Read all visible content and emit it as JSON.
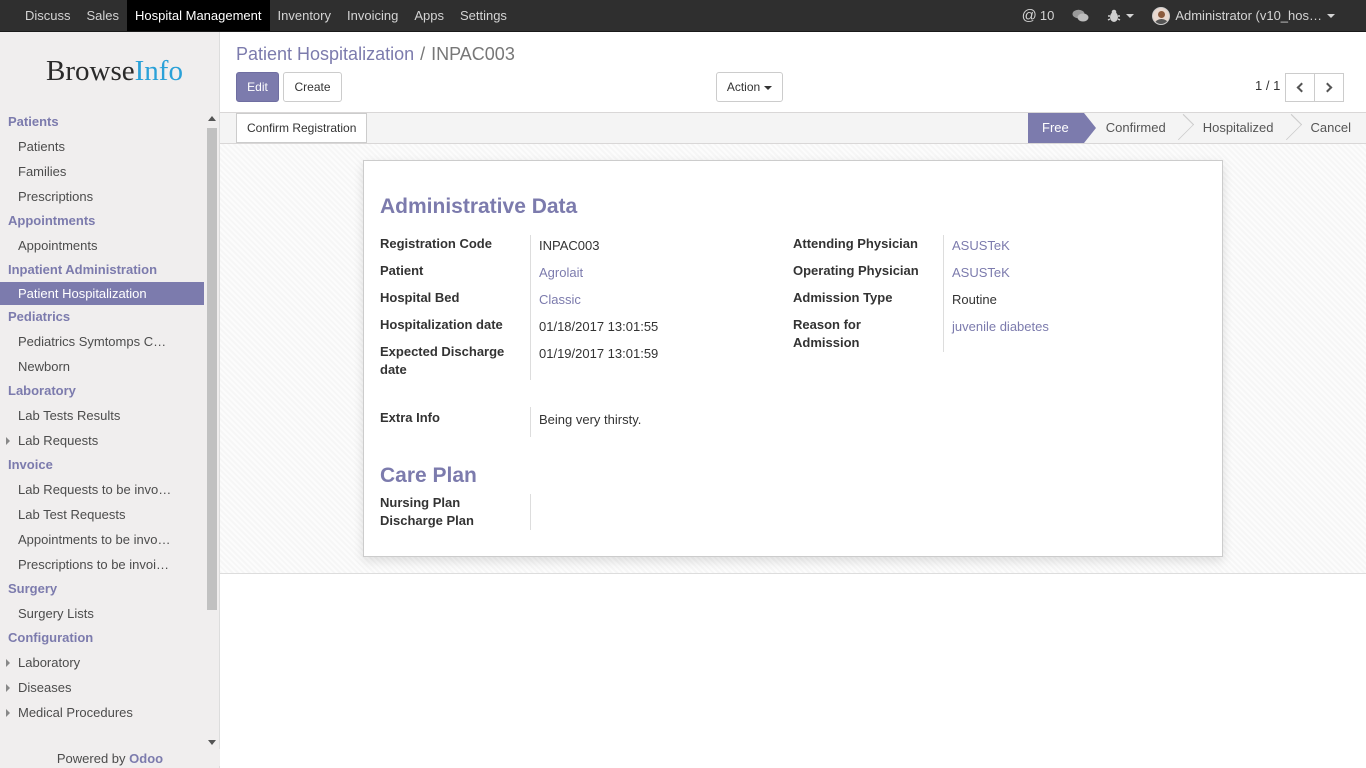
{
  "topbar": {
    "menu": [
      "Discuss",
      "Sales",
      "Hospital Management",
      "Inventory",
      "Invoicing",
      "Apps",
      "Settings"
    ],
    "active_index": 2,
    "mentions_count": "10",
    "user_label": "Administrator (v10_hos…"
  },
  "sidebar": {
    "logo_main": "Browse",
    "logo_accent": "Info",
    "sections": [
      {
        "heading": "Patients",
        "items": [
          {
            "label": "Patients"
          },
          {
            "label": "Families"
          },
          {
            "label": "Prescriptions"
          }
        ]
      },
      {
        "heading": "Appointments",
        "items": [
          {
            "label": "Appointments"
          }
        ]
      },
      {
        "heading": "Inpatient Administration",
        "items": [
          {
            "label": "Patient Hospitalization",
            "active": true
          }
        ]
      },
      {
        "heading": "Pediatrics",
        "items": [
          {
            "label": "Pediatrics Symtomps C…"
          },
          {
            "label": "Newborn"
          }
        ]
      },
      {
        "heading": "Laboratory",
        "items": [
          {
            "label": "Lab Tests Results"
          },
          {
            "label": "Lab Requests",
            "expandable": true
          }
        ]
      },
      {
        "heading": "Invoice",
        "items": [
          {
            "label": "Lab Requests to be invo…"
          },
          {
            "label": "Lab Test Requests"
          },
          {
            "label": "Appointments to be invo…"
          },
          {
            "label": "Prescriptions to be invoi…"
          }
        ]
      },
      {
        "heading": "Surgery",
        "items": [
          {
            "label": "Surgery Lists"
          }
        ]
      },
      {
        "heading": "Configuration",
        "items": [
          {
            "label": "Laboratory",
            "expandable": true
          },
          {
            "label": "Diseases",
            "expandable": true
          },
          {
            "label": "Medical Procedures",
            "expandable": true
          }
        ]
      }
    ],
    "powered_prefix": "Powered by",
    "powered_brand": "Odoo"
  },
  "breadcrumb": {
    "parent": "Patient Hospitalization",
    "separator": "/",
    "current": "INPAC003"
  },
  "buttons": {
    "edit": "Edit",
    "create": "Create",
    "action": "Action",
    "confirm_registration": "Confirm Registration"
  },
  "pager": {
    "text": "1 / 1"
  },
  "stages": [
    "Free",
    "Confirmed",
    "Hospitalized",
    "Cancel"
  ],
  "current_stage_index": 0,
  "form": {
    "admin_title": "Administrative Data",
    "registration_code_label": "Registration Code",
    "registration_code": "INPAC003",
    "patient_label": "Patient",
    "patient": "Agrolait",
    "hospital_bed_label": "Hospital Bed",
    "hospital_bed": "Classic",
    "hospitalization_date_label": "Hospitalization date",
    "hospitalization_date": "01/18/2017 13:01:55",
    "expected_discharge_label_1": "Expected Discharge",
    "expected_discharge_label_2": "date",
    "expected_discharge": "01/19/2017 13:01:59",
    "attending_physician_label": "Attending Physician",
    "attending_physician": "ASUSTeK",
    "operating_physician_label": "Operating Physician",
    "operating_physician": "ASUSTeK",
    "admission_type_label": "Admission Type",
    "admission_type": "Routine",
    "reason_label_1": "Reason for",
    "reason_label_2": "Admission",
    "reason": "juvenile diabetes",
    "extra_info_label": "Extra Info",
    "extra_info": "Being very thirsty.",
    "care_plan_title": "Care Plan",
    "nursing_plan_label": "Nursing Plan",
    "discharge_plan_label": "Discharge Plan"
  }
}
